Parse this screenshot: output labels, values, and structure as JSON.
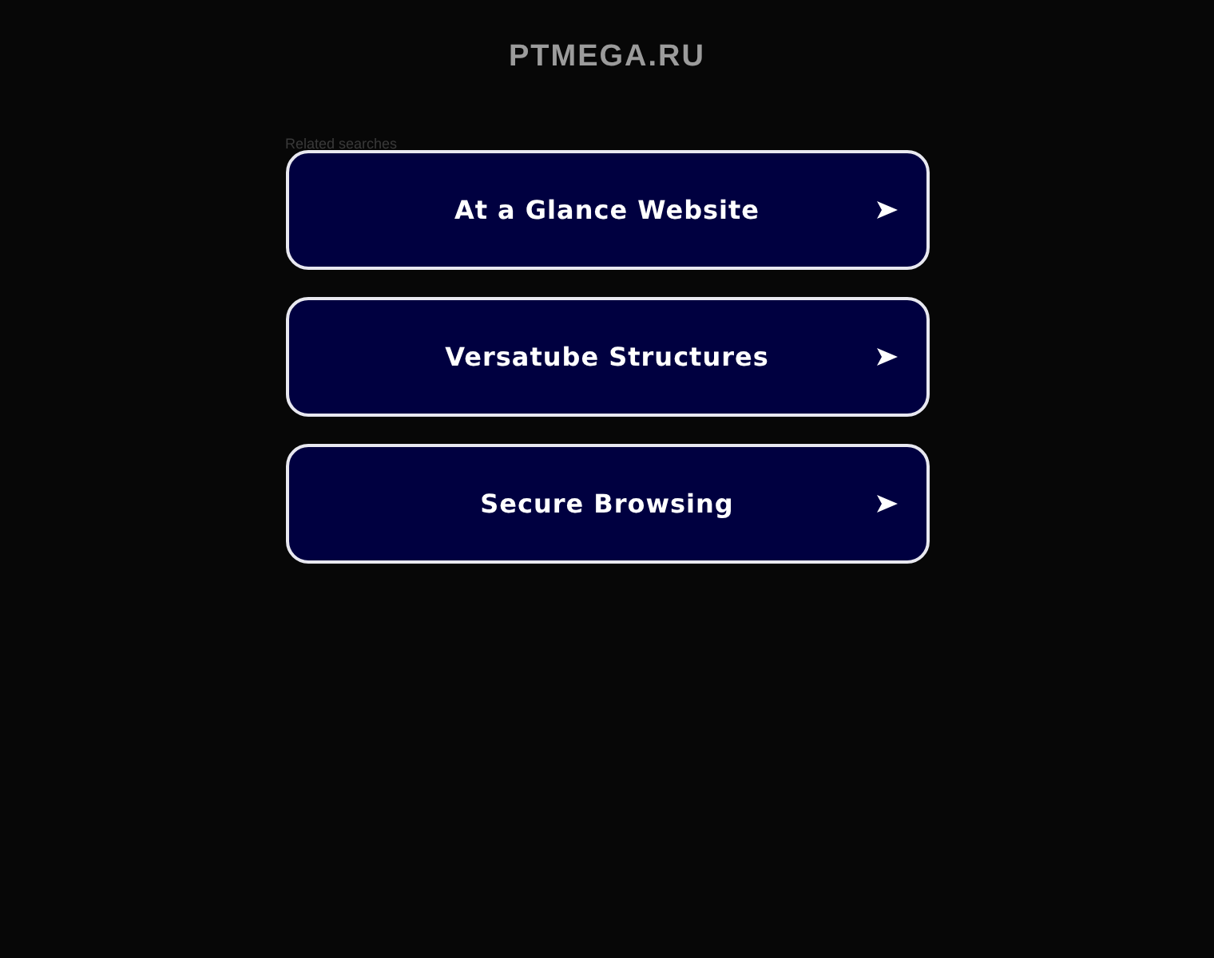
{
  "header": {
    "title": "PTMEGA.RU"
  },
  "related": {
    "heading": "Related searches",
    "links": [
      {
        "label": "At a Glance Website"
      },
      {
        "label": "Versatube Structures"
      },
      {
        "label": "Secure Browsing"
      }
    ]
  }
}
